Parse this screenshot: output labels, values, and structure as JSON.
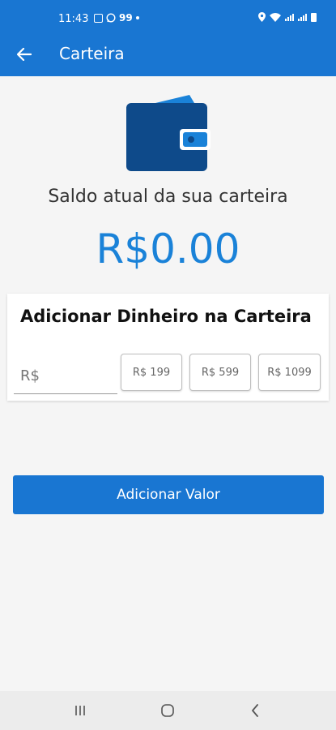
{
  "status_bar": {
    "time": "11:43",
    "badge": "99",
    "icons": [
      "image-icon",
      "whatsapp-icon",
      "dot-icon",
      "location-icon",
      "wifi-icon",
      "signal-icon",
      "battery-icon"
    ]
  },
  "toolbar": {
    "title": "Carteira",
    "back_icon": "arrow-left-icon"
  },
  "wallet": {
    "icon": "wallet-icon",
    "balance_label": "Saldo atual da sua carteira",
    "balance_value": "R$0.00"
  },
  "add_money": {
    "title": "Adicionar Dinheiro na Carteira",
    "amount_placeholder": "R$",
    "presets": [
      "R$ 199",
      "R$ 599",
      "R$ 1099"
    ]
  },
  "actions": {
    "add_value_label": "Adicionar Valor"
  },
  "colors": {
    "primary": "#1976d2",
    "balance": "#1a82d8",
    "wallet_dark": "#0e4a8a",
    "background": "#f5f5f5"
  },
  "nav_bar": {
    "icons": [
      "recent-apps-icon",
      "home-icon",
      "back-icon"
    ]
  }
}
